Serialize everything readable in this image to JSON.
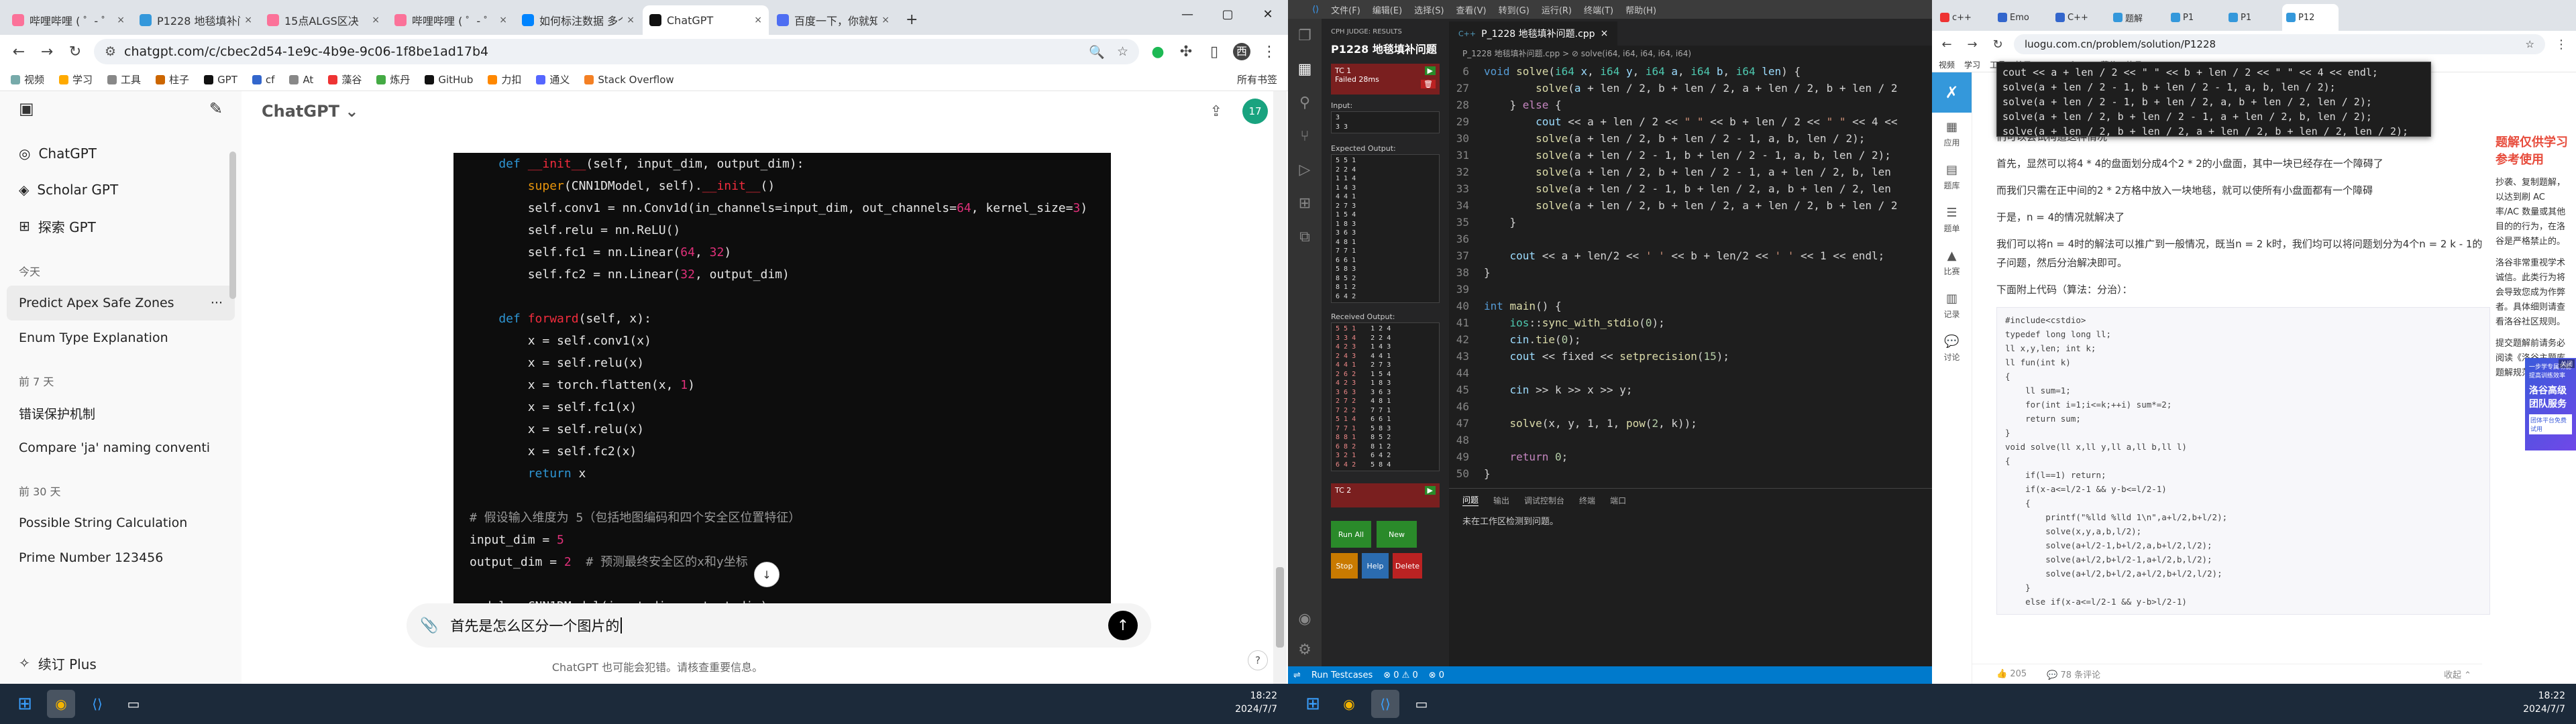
{
  "chrome1": {
    "tabs": [
      {
        "title": "哔哩哔哩 ( ゜- ゜)つロ",
        "color": "#fb7299"
      },
      {
        "title": "P1228 地毯填补问题",
        "color": "#3498db"
      },
      {
        "title": "15点ALGS区决",
        "color": "#fb7299"
      },
      {
        "title": "哔哩哔哩 ( ゜- ゜)つロ",
        "color": "#fb7299"
      },
      {
        "title": "如何标注数据 多个",
        "color": "#0084ff"
      },
      {
        "title": "ChatGPT",
        "color": "#111111"
      },
      {
        "title": "百度一下，你就知道",
        "color": "#4e6ef2"
      }
    ],
    "active_tab": 5,
    "url": "chatgpt.com/c/cbec2d54-1e9c-4b9e-9c06-1f8be1ad17b4",
    "bookmarks": [
      "视频",
      "学习",
      "工具",
      "柱子",
      "GPT",
      "cf",
      "At",
      "藻谷",
      "炼丹",
      "GitHub",
      "力扣",
      "通义",
      "Stack Overflow"
    ],
    "bookmarks_right": "所有书签"
  },
  "gpt": {
    "model": "ChatGPT",
    "nav": [
      "ChatGPT",
      "Scholar GPT",
      "探索 GPT"
    ],
    "sections": [
      {
        "label": "今天",
        "items": [
          "Predict Apex Safe Zones",
          "Enum Type Explanation"
        ]
      },
      {
        "label": "前 7 天",
        "items": [
          "错误保护机制",
          "Compare 'ja' naming conventi"
        ]
      },
      {
        "label": "前 30 天",
        "items": [
          "Possible String Calculation",
          "Prime Number 123456"
        ]
      }
    ],
    "upgrade": "续订 Plus",
    "avatar": "17",
    "input_text": "首先是怎么区分一个图片的",
    "disclaimer": "ChatGPT 也可能会犯错。请核查重要信息。",
    "help": "?"
  },
  "code_lines": [
    [
      [
        "kw",
        "    def "
      ],
      [
        "fn",
        "__init__"
      ],
      [
        "",
        "(self, input_dim, output_dim):"
      ]
    ],
    [
      [
        "",
        "        "
      ],
      [
        "bi",
        "super"
      ],
      [
        "",
        "(CNN1DModel, self)."
      ],
      [
        "fn",
        "__init__"
      ],
      [
        "",
        "()"
      ]
    ],
    [
      [
        "",
        "        self.conv1 = nn.Conv1d(in_channels=input_dim, out_channels="
      ],
      [
        "nm",
        "64"
      ],
      [
        "",
        ", kernel_size="
      ],
      [
        "nm",
        "3"
      ],
      [
        "",
        ")"
      ]
    ],
    [
      [
        "",
        "        self.relu = nn.ReLU()"
      ]
    ],
    [
      [
        "",
        "        self.fc1 = nn.Linear("
      ],
      [
        "nm",
        "64"
      ],
      [
        "",
        ", "
      ],
      [
        "nm",
        "32"
      ],
      [
        "",
        ")"
      ]
    ],
    [
      [
        "",
        "        self.fc2 = nn.Linear("
      ],
      [
        "nm",
        "32"
      ],
      [
        "",
        ", output_dim)"
      ]
    ],
    [
      [
        "",
        ""
      ]
    ],
    [
      [
        "kw",
        "    def "
      ],
      [
        "fn",
        "forward"
      ],
      [
        "",
        "(self, x):"
      ]
    ],
    [
      [
        "",
        "        x = self.conv1(x)"
      ]
    ],
    [
      [
        "",
        "        x = self.relu(x)"
      ]
    ],
    [
      [
        "",
        "        x = torch.flatten(x, "
      ],
      [
        "nm",
        "1"
      ],
      [
        "",
        ")"
      ]
    ],
    [
      [
        "",
        "        x = self.fc1(x)"
      ]
    ],
    [
      [
        "",
        "        x = self.relu(x)"
      ]
    ],
    [
      [
        "",
        "        x = self.fc2(x)"
      ]
    ],
    [
      [
        "kw",
        "        return"
      ],
      [
        "",
        " x"
      ]
    ],
    [
      [
        "",
        ""
      ]
    ],
    [
      [
        "cm",
        "# 假设输入维度为 5（包括地图编码和四个安全区位置特征）"
      ]
    ],
    [
      [
        "",
        "input_dim = "
      ],
      [
        "nm",
        "5"
      ]
    ],
    [
      [
        "",
        "output_dim = "
      ],
      [
        "nm",
        "2"
      ],
      [
        "",
        "  "
      ],
      [
        "cm",
        "# 预测最终安全区的x和y坐标"
      ]
    ],
    [
      [
        "",
        ""
      ]
    ],
    [
      [
        "",
        "model = CNN1DModel(input_dim, output_dim)"
      ]
    ]
  ],
  "vscode": {
    "menu": [
      "文件(F)",
      "编辑(E)",
      "选择(S)",
      "查看(V)",
      "转到(G)",
      "运行(R)",
      "终端(T)",
      "帮助(H)"
    ],
    "cph_header": "CPH JUDGE: RESULTS",
    "problem": "P1228 地毯填补问题",
    "tc1": "TC 1",
    "failed": "Failed",
    "time": "28ms",
    "input_label": "Input:",
    "input": [
      "3",
      "3 3"
    ],
    "expected_label": "Expected Output:",
    "expected": [
      "5 5 1",
      "2 2 4",
      "1 1 4",
      "1 4 3",
      "4 4 1",
      "2 7 3",
      "1 5 4",
      "1 8 3",
      "3 6 3",
      "4 8 1",
      "7 7 1",
      "6 6 1",
      "5 8 3",
      "8 5 2",
      "8 1 2",
      "6 4 2"
    ],
    "received_label": "Received Output:",
    "received_a": [
      "5 5 1",
      "3 3 4",
      "4 2 3",
      "2 4 3",
      "4 4 1",
      "2 6 2",
      "4 2 3",
      "3 6 3",
      "2 7 2",
      "7 2 2",
      "5 1 4",
      "7 7 1",
      "8 8 1",
      "6 8 2",
      "3 2 1",
      "6 4 2"
    ],
    "received_b": [
      "1 2 4",
      "2 2 4",
      "1 4 3",
      "4 4 1",
      "2 7 3",
      "1 5 4",
      "1 8 3",
      "3 6 3",
      "4 8 1",
      "7 7 1",
      "6 6 1",
      "5 8 3",
      "8 5 2",
      "8 1 2",
      "6 4 2",
      "5 8 4"
    ],
    "tc2": "TC 2",
    "btn_run": "Run All",
    "btn_new": "New",
    "btn_stop": "Stop",
    "btn_help": "Help",
    "btn_delete": "Delete",
    "file_tab": "P_1228 地毯填补问题.cpp",
    "breadcrumb": "P_1228 地毯填补问题.cpp > ⊘ solve(i64, i64, i64, i64, i64)",
    "panel_tabs": [
      "问题",
      "输出",
      "调试控制台",
      "终端",
      "端口"
    ],
    "panel_msg": "未在工作区检测到问题。",
    "status": [
      "Run Testcases",
      "⊗ 0  ⚠ 0",
      "⊗ 0"
    ]
  },
  "cpp": [
    {
      "n": "6",
      "t": [
        [
          "k1",
          "void "
        ],
        [
          "f1",
          "solve"
        ],
        [
          "p1",
          "("
        ],
        [
          "t1",
          "i64 "
        ],
        [
          "v1",
          "x"
        ],
        [
          "p1",
          ", "
        ],
        [
          "t1",
          "i64 "
        ],
        [
          "v1",
          "y"
        ],
        [
          "p1",
          ", "
        ],
        [
          "t1",
          "i64 "
        ],
        [
          "v1",
          "a"
        ],
        [
          "p1",
          ", "
        ],
        [
          "t1",
          "i64 "
        ],
        [
          "v1",
          "b"
        ],
        [
          "p1",
          ", "
        ],
        [
          "t1",
          "i64 "
        ],
        [
          "v1",
          "len"
        ],
        [
          "p1",
          ") {"
        ]
      ]
    },
    {
      "n": "27",
      "t": [
        [
          "p1",
          "        "
        ],
        [
          "f1",
          "solve"
        ],
        [
          "p1",
          "("
        ],
        [
          "v1",
          "a"
        ],
        [
          "p1",
          " + len / 2, b + len / 2, a + len / 2, b + len / 2"
        ]
      ]
    },
    {
      "n": "28",
      "t": [
        [
          "p1",
          "    } "
        ],
        [
          "k2",
          "else"
        ],
        [
          "p1",
          " {"
        ]
      ]
    },
    {
      "n": "29",
      "t": [
        [
          "p1",
          "        "
        ],
        [
          "v1",
          "cout"
        ],
        [
          "p1",
          " << a + len / 2 << "
        ],
        [
          "s1",
          "\" \""
        ],
        [
          "p1",
          " << b + len / 2 << "
        ],
        [
          "s1",
          "\" \""
        ],
        [
          "p1",
          " << 4 <<"
        ]
      ]
    },
    {
      "n": "30",
      "t": [
        [
          "p1",
          "        "
        ],
        [
          "f1",
          "solve"
        ],
        [
          "p1",
          "(a + len / 2, b + len / 2 - 1, a, b, len / 2);"
        ]
      ]
    },
    {
      "n": "31",
      "t": [
        [
          "p1",
          "        "
        ],
        [
          "f1",
          "solve"
        ],
        [
          "p1",
          "(a + len / 2 - 1, b + len / 2 - 1, a, b, len / 2);"
        ]
      ]
    },
    {
      "n": "32",
      "t": [
        [
          "p1",
          "        "
        ],
        [
          "f1",
          "solve"
        ],
        [
          "p1",
          "(a + len / 2, b + len / 2 - 1, a + len / 2, b, len"
        ]
      ]
    },
    {
      "n": "33",
      "t": [
        [
          "p1",
          "        "
        ],
        [
          "f1",
          "solve"
        ],
        [
          "p1",
          "(a + len / 2 - 1, b + len / 2, a, b + len / 2, len"
        ]
      ]
    },
    {
      "n": "34",
      "t": [
        [
          "p1",
          "        "
        ],
        [
          "f1",
          "solve"
        ],
        [
          "p1",
          "(a + len / 2, b + len / 2, a + len / 2, b + len / 2"
        ]
      ]
    },
    {
      "n": "35",
      "t": [
        [
          "p1",
          "    }"
        ]
      ]
    },
    {
      "n": "36",
      "t": [
        [
          "p1",
          ""
        ]
      ]
    },
    {
      "n": "37",
      "t": [
        [
          "p1",
          "    "
        ],
        [
          "v1",
          "cout"
        ],
        [
          "p1",
          " << a + len/2 << "
        ],
        [
          "s1",
          "' '"
        ],
        [
          "p1",
          " << b + len/2 << "
        ],
        [
          "s1",
          "' '"
        ],
        [
          "p1",
          " << 1 << endl;"
        ]
      ]
    },
    {
      "n": "38",
      "t": [
        [
          "p1",
          "}"
        ]
      ]
    },
    {
      "n": "39",
      "t": [
        [
          "p1",
          ""
        ]
      ]
    },
    {
      "n": "40",
      "t": [
        [
          "k1",
          "int "
        ],
        [
          "f1",
          "main"
        ],
        [
          "p1",
          "() {"
        ]
      ]
    },
    {
      "n": "41",
      "t": [
        [
          "p1",
          "    "
        ],
        [
          "t1",
          "ios"
        ],
        [
          "p1",
          "::"
        ],
        [
          "f1",
          "sync_with_stdio"
        ],
        [
          "p1",
          "("
        ],
        [
          "n1",
          "0"
        ],
        [
          "p1",
          ");"
        ]
      ]
    },
    {
      "n": "42",
      "t": [
        [
          "p1",
          "    "
        ],
        [
          "v1",
          "cin"
        ],
        [
          "p1",
          "."
        ],
        [
          "f1",
          "tie"
        ],
        [
          "p1",
          "("
        ],
        [
          "n1",
          "0"
        ],
        [
          "p1",
          ");"
        ]
      ]
    },
    {
      "n": "43",
      "t": [
        [
          "p1",
          "    "
        ],
        [
          "v1",
          "cout"
        ],
        [
          "p1",
          " << fixed << "
        ],
        [
          "f1",
          "setprecision"
        ],
        [
          "p1",
          "("
        ],
        [
          "n1",
          "15"
        ],
        [
          "p1",
          ");"
        ]
      ]
    },
    {
      "n": "44",
      "t": [
        [
          "p1",
          ""
        ]
      ]
    },
    {
      "n": "45",
      "t": [
        [
          "p1",
          "    "
        ],
        [
          "v1",
          "cin"
        ],
        [
          "p1",
          " >> k >> x >> y;"
        ]
      ]
    },
    {
      "n": "46",
      "t": [
        [
          "p1",
          ""
        ]
      ]
    },
    {
      "n": "47",
      "t": [
        [
          "p1",
          "    "
        ],
        [
          "f1",
          "solve"
        ],
        [
          "p1",
          "(x, y, 1, 1, "
        ],
        [
          "f1",
          "pow"
        ],
        [
          "p1",
          "("
        ],
        [
          "n1",
          "2"
        ],
        [
          "p1",
          ", k));"
        ]
      ]
    },
    {
      "n": "48",
      "t": [
        [
          "p1",
          ""
        ]
      ]
    },
    {
      "n": "49",
      "t": [
        [
          "p1",
          "    "
        ],
        [
          "k2",
          "return "
        ],
        [
          "n1",
          "0"
        ],
        [
          "p1",
          ";"
        ]
      ]
    },
    {
      "n": "50",
      "t": [
        [
          "p1",
          "}"
        ]
      ]
    }
  ],
  "chrome2": {
    "tabs": [
      "c++",
      "Emo",
      "C++",
      "题解",
      "P1",
      "P1",
      "P12"
    ],
    "url": "luogu.com.cn/problem/solution/P1228",
    "bookmarks": [
      "视频",
      "学习",
      "工具",
      "柱子",
      "GPT",
      "cf",
      "At",
      "藻谷",
      "炼丹"
    ],
    "side": [
      "应用",
      "题库",
      "题单",
      "比赛",
      "记录",
      "讨论"
    ],
    "popup": [
      "cout << a + len / 2 << \" \" << b + len / 2 << \" \" << 4 << endl;",
      "solve(a + len / 2 - 1, b + len / 2 - 1, a, b, len / 2);",
      "solve(a + len / 2 - 1, b + len / 2, a, b + len / 2, len / 2);",
      "solve(a + len / 2, b + len / 2 - 1, a + len / 2, b, len / 2);",
      "solve(a + len / 2, b + len / 2, a + len / 2, b + len / 2, len / 2);"
    ],
    "article": [
      "们可以尝试构造这种情况",
      "首先，显然可以将4 * 4的盘面划分成4个2 * 2的小盘面，其中一块已经存在一个障碍了",
      "而我们只需在正中间的2 * 2方格中放入一块地毯，就可以使所有小盘面都有一个障碍",
      "于是，n = 4的情况就解决了",
      "我们可以将n = 4时的解法可以推广到一般情况，既当n = 2 k时，我们均可以将问题划分为4个n = 2 k - 1的子问题，然后分治解决即可。",
      "下面附上代码（算法：分治）："
    ],
    "code": [
      "#include<cstdio>",
      "typedef long long ll;",
      "ll x,y,len; int k;",
      "ll fun(int k)",
      "{",
      "    ll sum=1;",
      "    for(int i=1;i<=k;++i) sum*=2;",
      "    return sum;",
      "}",
      "void solve(ll x,ll y,ll a,ll b,ll l)",
      "{",
      "    if(l==1) return;",
      "    if(x-a<=l/2-1 && y-b<=l/2-1)",
      "    {",
      "        printf(\"%lld %lld 1\\n\",a+l/2,b+l/2);",
      "        solve(x,y,a,b,l/2);",
      "        solve(a+l/2-1,b+l/2,a,b+l/2,l/2);",
      "        solve(a+l/2,b+l/2-1,a+l/2,b,l/2);",
      "        solve(a+l/2,b+l/2,a+l/2,b+l/2,l/2);",
      "    }",
      "    else if(x-a<=l/2-1 && y-b>l/2-1)"
    ],
    "footer_like": "205",
    "footer_comment": "78 条评论",
    "footer_collapse": "收起",
    "right_heading": "题解仅供学习参考使用",
    "right_p1": "抄袭、复制题解，以达到刷 AC 率/AC 数量或其他目的的行为，在洛谷是严格禁止的。",
    "right_p2": "洛谷非常重视学术诚信。此类行为将会导致您成为作弊者。具体细则请查看洛谷社区规则。",
    "right_p3": "提交题解前请务必阅读《洛谷主题库题解规范》。",
    "ad_title": "洛谷高级团队服务",
    "ad_sub": "一步学专属功能 提高训练效率",
    "ad_btn": "团体平台免费试用",
    "ad_close": "关闭"
  },
  "taskbar": {
    "time_left": "18:22",
    "date_left": "2024/7/7",
    "time_right": "18:22",
    "date_right": "2024/7/7"
  }
}
